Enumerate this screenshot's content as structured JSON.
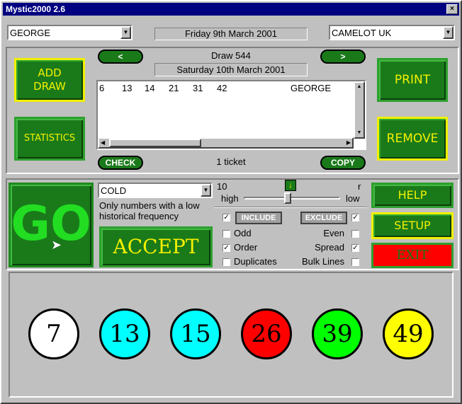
{
  "window": {
    "title": "Mystic2000 2.6",
    "close": "×"
  },
  "header": {
    "player": "GEORGE",
    "date": "Friday 9th March 2001",
    "lottery": "CAMELOT UK"
  },
  "draw": {
    "prev": "<",
    "next": ">",
    "number": "Draw 544",
    "date": "Saturday 10th March 2001"
  },
  "tickets": {
    "numbers": [
      "6",
      "13",
      "14",
      "21",
      "31",
      "42"
    ],
    "name": "GEORGE",
    "count": "1 ticket"
  },
  "buttons": {
    "add_draw": "ADD DRAW",
    "statistics": "STATISTICS",
    "print": "PRINT",
    "remove": "REMOVE",
    "check": "CHECK",
    "copy": "COPY",
    "go": "GO",
    "accept": "ACCEPT",
    "help": "HELP",
    "setup": "SETUP",
    "exit": "EXIT"
  },
  "filter": {
    "mode": "COLD",
    "description": "Only numbers with a low historical frequency"
  },
  "slider": {
    "left_value": "10",
    "right_value": "r",
    "high": "high",
    "low": "low",
    "position": 0.45
  },
  "options": {
    "include": "INCLUDE",
    "exclude": "EXCLUDE",
    "include_checked": true,
    "exclude_checked": true,
    "left": [
      {
        "label": "Odd",
        "checked": false
      },
      {
        "label": "Order",
        "checked": true
      },
      {
        "label": "Duplicates",
        "checked": false
      }
    ],
    "right": [
      {
        "label": "Even",
        "checked": false
      },
      {
        "label": "Spread",
        "checked": true
      },
      {
        "label": "Bulk Lines",
        "checked": false
      }
    ]
  },
  "balls": [
    {
      "n": "7",
      "color": "#ffffff"
    },
    {
      "n": "13",
      "color": "#00ffff"
    },
    {
      "n": "15",
      "color": "#00ffff"
    },
    {
      "n": "26",
      "color": "#ff0000"
    },
    {
      "n": "39",
      "color": "#00ff00"
    },
    {
      "n": "49",
      "color": "#ffff00"
    }
  ]
}
